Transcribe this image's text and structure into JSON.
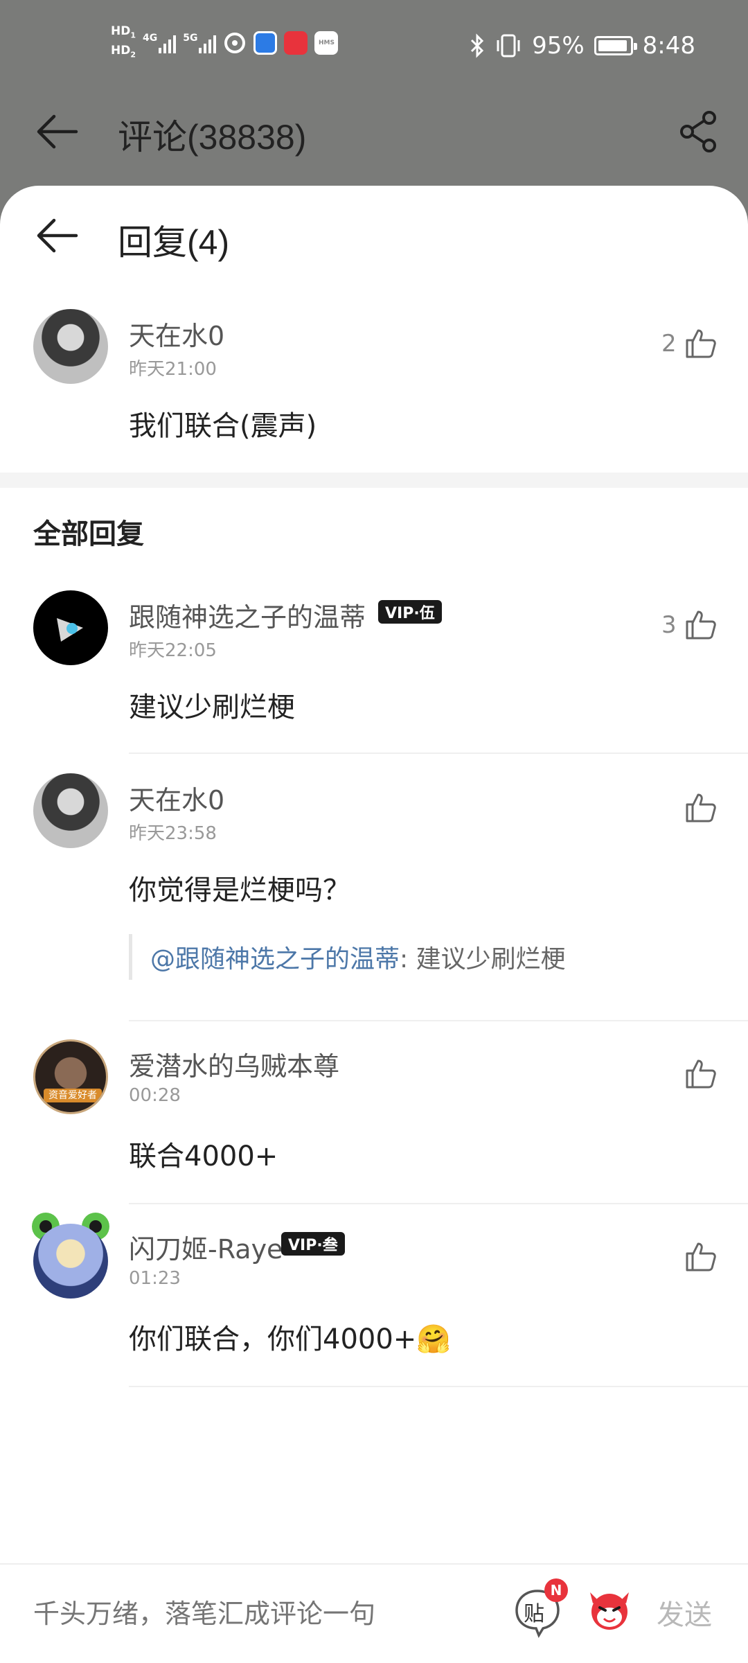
{
  "status_bar": {
    "hd1": "HD",
    "hd1_sub": "1",
    "hd2": "HD",
    "hd2_sub": "2",
    "net1": "4G",
    "net2": "5G",
    "hms": "HMS",
    "battery_percent": "95%",
    "battery_level": 0.95,
    "time": "8:48"
  },
  "background_header": {
    "title": "评论(38838)"
  },
  "sheet": {
    "title": "回复(4)",
    "main_comment": {
      "username": "天在水0",
      "time": "昨天21:00",
      "likes": "2",
      "text": "我们联合(震声)"
    },
    "section_title": "全部回复",
    "replies": [
      {
        "username": "跟随神选之子的温蒂",
        "vip": "VIP·伍",
        "time": "昨天22:05",
        "likes": "3",
        "text": "建议少刷烂梗"
      },
      {
        "username": "天在水0",
        "time": "昨天23:58",
        "likes": "",
        "text": "你觉得是烂梗吗？",
        "quote_mention": "@跟随神选之子的温蒂",
        "quote_text": ": 建议少刷烂梗"
      },
      {
        "username": "爱潜水的乌贼本尊",
        "avatar_badge": "资音爱好者",
        "time": "00:28",
        "likes": "",
        "text": "联合4000+"
      },
      {
        "username": "闪刀姬-Raye",
        "vip": "VIP·叁",
        "time": "01:23",
        "likes": "",
        "text": "你们联合，你们4000+🤗"
      }
    ]
  },
  "bottom_bar": {
    "placeholder": "千头万绪，落笔汇成评论一句",
    "post_icon_label": "贴",
    "post_badge": "N",
    "send_label": "发送"
  },
  "colors": {
    "dim_background": "#7a7b79",
    "mention": "#4c77a8",
    "vip_badge": "#1a1a1a",
    "badge_red": "#e8333c"
  },
  "icons": [
    "back-arrow-icon",
    "share-icon",
    "thumbs-up-icon",
    "post-icon",
    "emoji-face-icon",
    "bluetooth-icon",
    "vibrate-icon",
    "battery-icon"
  ]
}
